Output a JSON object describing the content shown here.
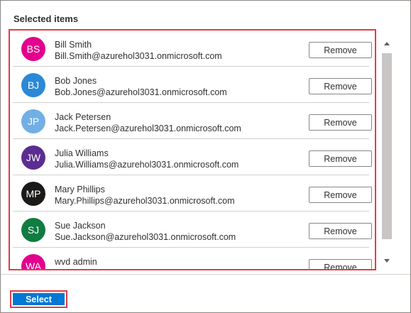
{
  "panel": {
    "title": "Selected items",
    "remove_label": "Remove",
    "select_label": "Select"
  },
  "items": [
    {
      "initials": "BS",
      "name": "Bill Smith",
      "email": "Bill.Smith@azurehol3031.onmicrosoft.com",
      "color": "#e3008c"
    },
    {
      "initials": "BJ",
      "name": "Bob Jones",
      "email": "Bob.Jones@azurehol3031.onmicrosoft.com",
      "color": "#2b88d8"
    },
    {
      "initials": "JP",
      "name": "Jack Petersen",
      "email": "Jack.Petersen@azurehol3031.onmicrosoft.com",
      "color": "#71afe5"
    },
    {
      "initials": "JW",
      "name": "Julia Williams",
      "email": "Julia.Williams@azurehol3031.onmicrosoft.com",
      "color": "#5c2d91"
    },
    {
      "initials": "MP",
      "name": "Mary Phillips",
      "email": "Mary.Phillips@azurehol3031.onmicrosoft.com",
      "color": "#1b1a19"
    },
    {
      "initials": "SJ",
      "name": "Sue Jackson",
      "email": "Sue.Jackson@azurehol3031.onmicrosoft.com",
      "color": "#107c41"
    },
    {
      "initials": "WA",
      "name": "wvd admin",
      "email": "",
      "color": "#e3008c"
    }
  ],
  "colors": {
    "accent": "#0078d4",
    "highlight": "#e03e47"
  }
}
